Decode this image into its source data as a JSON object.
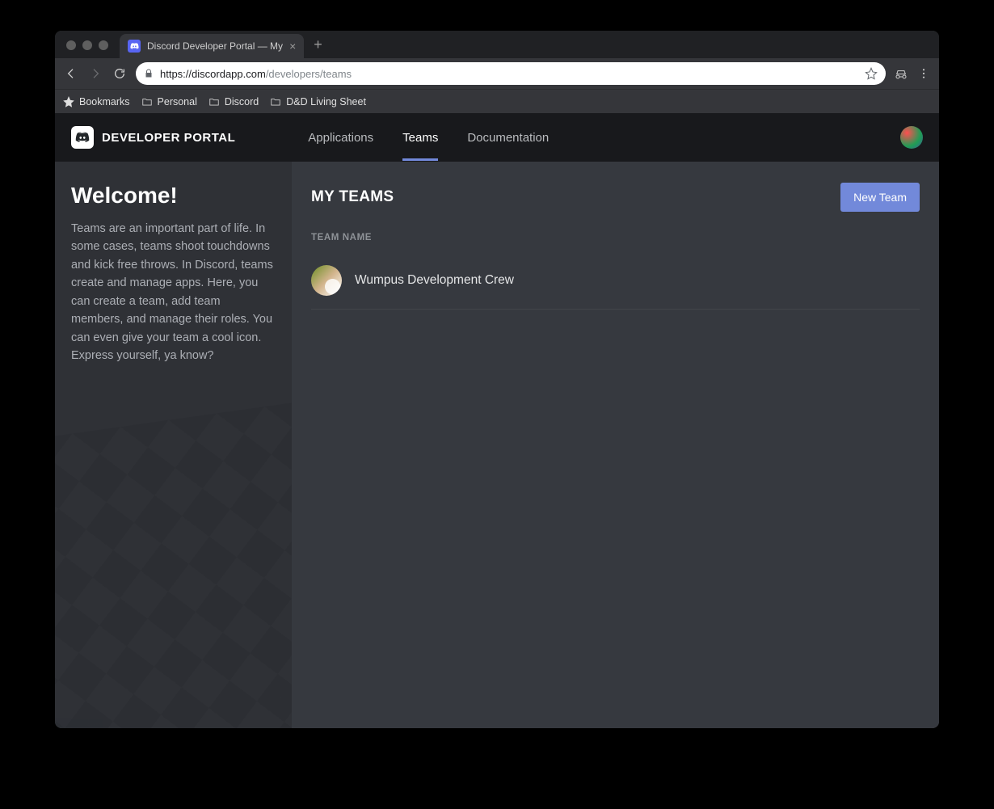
{
  "browser": {
    "tab_title": "Discord Developer Portal — My",
    "url_protocol": "https://",
    "url_host": "discordapp.com",
    "url_path": "/developers/teams"
  },
  "bookmarks_bar": {
    "items": [
      "Bookmarks",
      "Personal",
      "Discord",
      "D&D Living Sheet"
    ]
  },
  "header": {
    "brand": "DEVELOPER PORTAL",
    "nav": {
      "applications": "Applications",
      "teams": "Teams",
      "documentation": "Documentation"
    }
  },
  "sidebar": {
    "title": "Welcome!",
    "body": "Teams are an important part of life. In some cases, teams shoot touchdowns and kick free throws. In Discord, teams create and manage apps. Here, you can create a team, add team members, and manage their roles. You can even give your team a cool icon. Express yourself, ya know?"
  },
  "main": {
    "heading": "MY TEAMS",
    "new_team_label": "New Team",
    "column_header": "TEAM NAME",
    "teams": [
      {
        "name": "Wumpus Development Crew"
      }
    ]
  }
}
